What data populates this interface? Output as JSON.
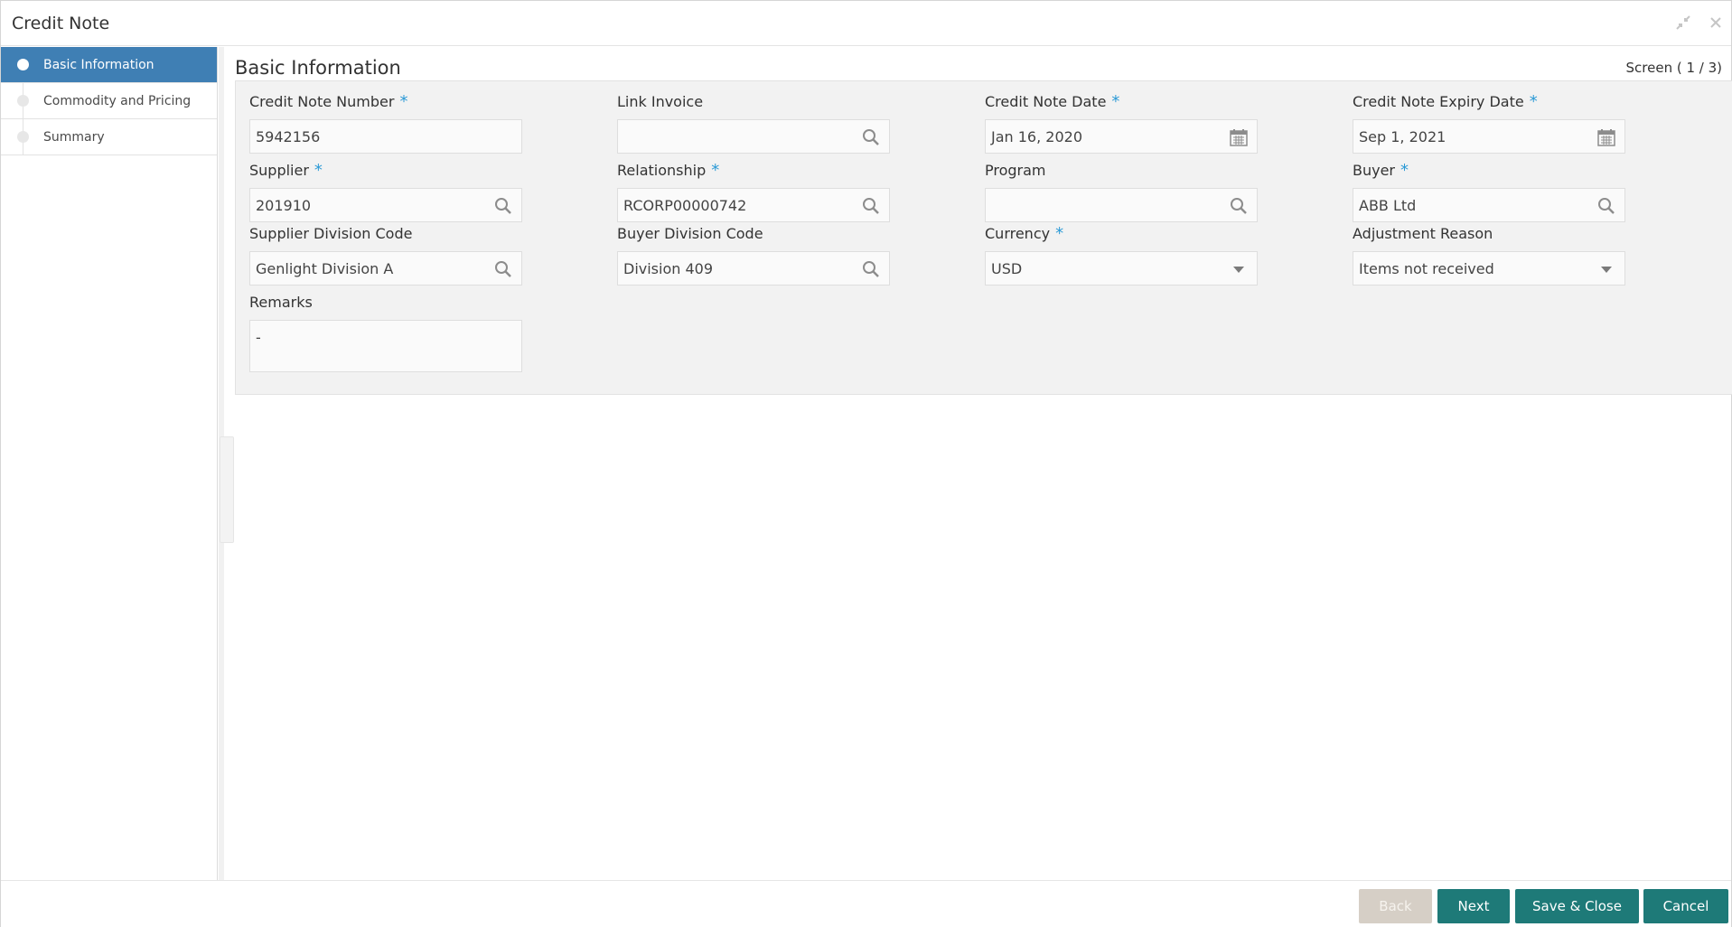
{
  "window": {
    "title": "Credit Note"
  },
  "sidebar": {
    "items": [
      {
        "label": "Basic Information"
      },
      {
        "label": "Commodity and Pricing"
      },
      {
        "label": "Summary"
      }
    ]
  },
  "content": {
    "title": "Basic Information",
    "screen_indicator": "Screen ( 1 / 3)"
  },
  "fields": {
    "credit_note_number": {
      "label": "Credit Note Number",
      "value": "5942156",
      "required": "*"
    },
    "link_invoice": {
      "label": "Link Invoice",
      "value": ""
    },
    "credit_note_date": {
      "label": "Credit Note Date",
      "value": "Jan 16, 2020",
      "required": "*"
    },
    "credit_note_expiry_date": {
      "label": "Credit Note Expiry Date",
      "value": "Sep 1, 2021",
      "required": "*"
    },
    "supplier": {
      "label": "Supplier",
      "value": "201910",
      "required": "*"
    },
    "relationship": {
      "label": "Relationship",
      "value": "RCORP00000742",
      "required": "*"
    },
    "program": {
      "label": "Program",
      "value": ""
    },
    "buyer": {
      "label": "Buyer",
      "value": "ABB Ltd",
      "required": "*"
    },
    "supplier_division_code": {
      "label": "Supplier Division Code",
      "value": "Genlight Division A"
    },
    "buyer_division_code": {
      "label": "Buyer Division Code",
      "value": "Division 409"
    },
    "currency": {
      "label": "Currency",
      "value": "USD",
      "required": "*"
    },
    "adjustment_reason": {
      "label": "Adjustment Reason",
      "value": "Items not received"
    },
    "remarks": {
      "label": "Remarks",
      "value": "-"
    }
  },
  "footer": {
    "back_label": "Back",
    "next_label": "Next",
    "save_close_label": "Save & Close",
    "cancel_label": "Cancel"
  },
  "colors": {
    "accent": "#3f7fb4",
    "button": "#1e7a78",
    "required": "#2c9ad6",
    "disabled_button": "#d6cfc6"
  },
  "icons": {
    "search": "search-icon",
    "calendar": "calendar-icon",
    "dropdown": "chevron-down-icon",
    "minimize": "minimize-icon",
    "close": "close-icon"
  }
}
